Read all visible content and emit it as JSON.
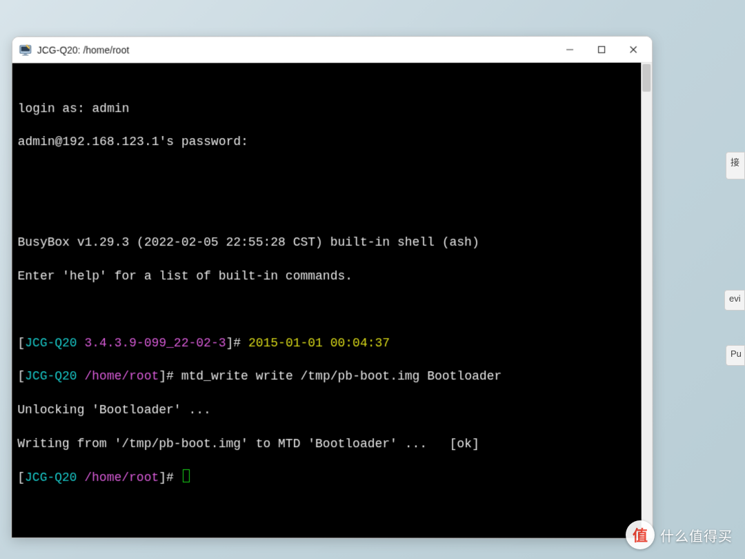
{
  "window": {
    "title": "JCG-Q20: /home/root"
  },
  "terminal": {
    "login_as_label": "login as: ",
    "login_user": "admin",
    "pw_prompt": "admin@192.168.123.1's password:",
    "banner1": "BusyBox v1.29.3 (2022-02-05 22:55:28 CST) built-in shell (ash)",
    "banner2": "Enter 'help' for a list of built-in commands.",
    "p1": {
      "br_open": "[",
      "host": "JCG-Q20",
      "sep": " ",
      "ver": "3.4.3.9-099_22-02-3",
      "br_close": "]# ",
      "ts": "2015-01-01 00:04:37"
    },
    "p2": {
      "br_open": "[",
      "host": "JCG-Q20",
      "sep": " ",
      "path": "/home/root",
      "br_close": "]# ",
      "cmd": "mtd_write write /tmp/pb-boot.img Bootloader"
    },
    "out1": "Unlocking 'Bootloader' ...",
    "out2": "Writing from '/tmp/pb-boot.img' to MTD 'Bootloader' ...   [ok]",
    "p3": {
      "br_open": "[",
      "host": "JCG-Q20",
      "sep": " ",
      "path": "/home/root",
      "br_close": "]# "
    }
  },
  "bg": {
    "t1": "接",
    "t2": "evi",
    "t3": "Pu"
  },
  "watermark": {
    "badge": "值",
    "text": "什么值得买"
  }
}
